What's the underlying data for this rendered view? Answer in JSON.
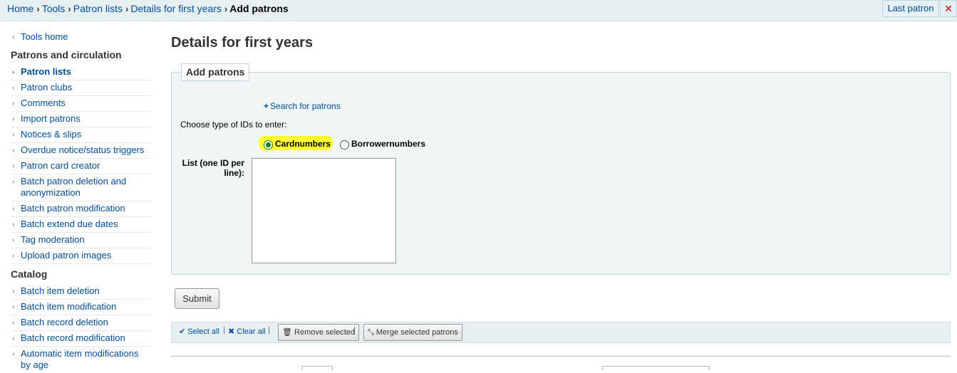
{
  "breadcrumb": {
    "items": [
      "Home",
      "Tools",
      "Patron lists",
      "Details for first years"
    ],
    "current": "Add patrons",
    "separator": "›"
  },
  "header": {
    "last_patron_label": "Last patron",
    "close_glyph": "✕"
  },
  "sidebar": {
    "chevron": "›",
    "tools_home": "Tools home",
    "section_patrons": "Patrons and circulation",
    "patron_items": [
      "Patron lists",
      "Patron clubs",
      "Comments",
      "Import patrons",
      "Notices & slips",
      "Overdue notice/status triggers",
      "Patron card creator",
      "Batch patron deletion and anonymization",
      "Batch patron modification",
      "Batch extend due dates",
      "Tag moderation",
      "Upload patron images"
    ],
    "section_catalog": "Catalog",
    "catalog_items": [
      "Batch item deletion",
      "Batch item modification",
      "Batch record deletion",
      "Batch record modification",
      "Automatic item modifications by age"
    ]
  },
  "main": {
    "title": "Details for first years",
    "legend": "Add patrons",
    "search_link": "Search for patrons",
    "search_plus": "+",
    "choose_label": "Choose type of IDs to enter:",
    "radio_cardnumbers": "Cardnumbers",
    "radio_borrowernumbers": "Borrowernumbers",
    "list_label": "List (one ID per line):",
    "list_value": "",
    "submit_label": "Submit"
  },
  "toolbar": {
    "select_all": "Select all",
    "clear_all": "Clear all",
    "check_glyph": "✔",
    "x_glyph": "✖",
    "pipe": "|",
    "remove_selected": "Remove selected",
    "trash_glyph": "🗑",
    "merge_selected": "Merge selected patrons",
    "merge_glyph": "⤡"
  },
  "colors": {
    "link": "#004d99",
    "highlight": "#ffff33",
    "panel_bg": "#f0f5f6",
    "crumb_bg": "#e6f0f2",
    "close_red": "#cc0000"
  }
}
